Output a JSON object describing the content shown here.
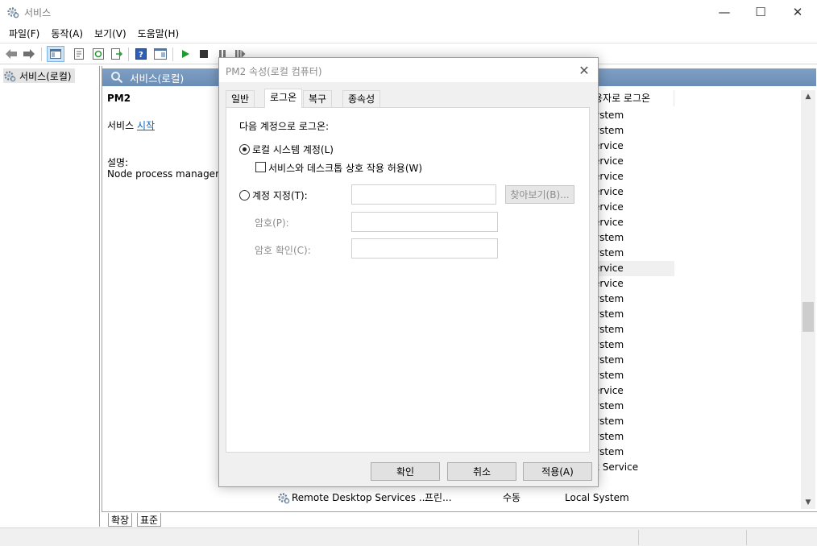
{
  "window": {
    "title": "서비스",
    "controls": {
      "minimize": "—",
      "maximize": "☐",
      "close": "✕"
    }
  },
  "menu": [
    {
      "label": "파일(F)"
    },
    {
      "label": "동작(A)"
    },
    {
      "label": "보기(V)"
    },
    {
      "label": "도움말(H)"
    }
  ],
  "tree": {
    "root_label": "서비스(로컬)"
  },
  "pane": {
    "header": "서비스(로컬)",
    "selected_service": "PM2",
    "start_prefix": "서비스 ",
    "start_link": "시작",
    "desc_label": "설명:",
    "desc_text": "Node process manager"
  },
  "list": {
    "logon_header": "용자로 로그온",
    "logon_cells": [
      "ystem",
      "ystem",
      "ervice",
      "ervice",
      "ervice",
      "ervice",
      "ervice",
      "ervice",
      "ystem",
      "ystem",
      "ervice",
      "ervice",
      "ystem",
      "ystem",
      "ystem",
      "ystem",
      "ystem",
      "ystem",
      "ervice",
      "ystem",
      "ystem",
      "ystem",
      "ystem",
      "k Service"
    ],
    "selected_index": 10,
    "row_remote": {
      "name": "Remote Desktop Services ...",
      "status": "프린...",
      "startup": "수동",
      "logon": "Local System"
    }
  },
  "bottom_tabs": [
    {
      "label": "확장"
    },
    {
      "label": "표준"
    }
  ],
  "dialog": {
    "title": "PM2 속성(로컬 컴퓨터)",
    "close": "✕",
    "tabs": [
      {
        "label": "일반"
      },
      {
        "label": "로그온"
      },
      {
        "label": "복구"
      },
      {
        "label": "종속성"
      }
    ],
    "active_tab": 1,
    "logon_as_label": "다음 계정으로 로그온:",
    "local_system": "로컬 시스템 계정(L)",
    "allow_desktop": "서비스와 데스크톱 상호 작용 허용(W)",
    "this_account": "계정 지정(T):",
    "password": "암호(P):",
    "confirm_password": "암호 확인(C):",
    "account_value": "",
    "password_value": "",
    "confirm_value": "",
    "browse": "찾아보기(B)...",
    "ok": "확인",
    "cancel": "취소",
    "apply": "적용(A)"
  }
}
